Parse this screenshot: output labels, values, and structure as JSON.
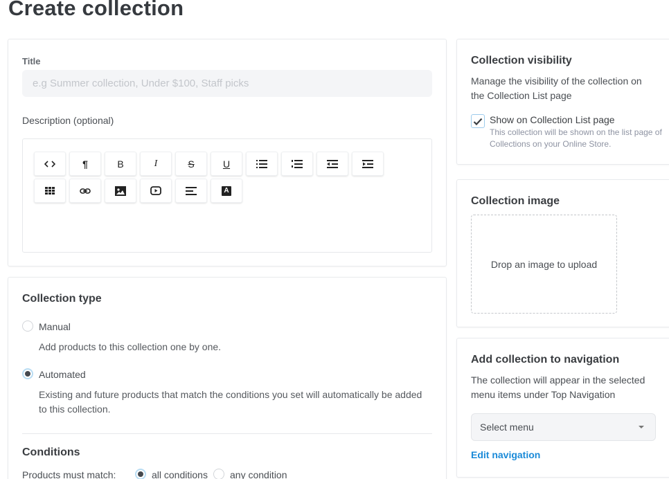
{
  "page": {
    "title": "Create collection"
  },
  "main_card": {
    "title_label": "Title",
    "title_placeholder": "e.g Summer collection, Under $100, Staff picks",
    "title_value": "",
    "description_label": "Description (optional)",
    "toolbar_row1": [
      {
        "name": "code-view",
        "icon": "code-icon",
        "glyph": "<>"
      },
      {
        "name": "paragraph",
        "icon": "paragraph-icon",
        "glyph": "¶"
      },
      {
        "name": "bold",
        "icon": "bold-icon",
        "glyph": "B"
      },
      {
        "name": "italic",
        "icon": "italic-icon",
        "glyph": "I"
      },
      {
        "name": "strikethrough",
        "icon": "strikethrough-icon",
        "glyph": "S"
      },
      {
        "name": "underline",
        "icon": "underline-icon",
        "glyph": "U"
      },
      {
        "name": "bullet-list",
        "icon": "bullet-list-icon",
        "glyph": ""
      },
      {
        "name": "numbered-list",
        "icon": "numbered-list-icon",
        "glyph": ""
      },
      {
        "name": "outdent",
        "icon": "outdent-icon",
        "glyph": ""
      },
      {
        "name": "indent",
        "icon": "indent-icon",
        "glyph": ""
      }
    ],
    "toolbar_row2": [
      {
        "name": "table",
        "icon": "table-icon"
      },
      {
        "name": "link",
        "icon": "link-icon"
      },
      {
        "name": "image",
        "icon": "image-icon"
      },
      {
        "name": "video",
        "icon": "video-icon"
      },
      {
        "name": "align",
        "icon": "align-left-icon"
      },
      {
        "name": "text-color",
        "icon": "text-color-icon",
        "glyph": "A"
      }
    ]
  },
  "type_card": {
    "heading": "Collection type",
    "options": [
      {
        "label": "Manual",
        "help": "Add products to this collection one by one.",
        "checked": false
      },
      {
        "label": "Automated",
        "help": "Existing and future products that match the conditions you set will automatically be added to this collection.",
        "checked": true
      }
    ],
    "conditions_heading": "Conditions",
    "match_label": "Products must match:",
    "match_options": [
      {
        "label": "all conditions",
        "checked": true
      },
      {
        "label": "any condition",
        "checked": false
      }
    ]
  },
  "visibility_card": {
    "heading": "Collection visibility",
    "description": "Manage the visibility of the collection on the Collection List page",
    "checkbox_label": "Show on Collection List page",
    "checkbox_checked": true,
    "checkbox_help": "This collection will be shown on the list page of Collections on your Online Store."
  },
  "image_card": {
    "heading": "Collection image",
    "dropzone_text": "Drop an image to upload"
  },
  "navigation_card": {
    "heading": "Add collection to navigation",
    "description": "The collection will appear in the selected menu items under Top Navigation",
    "select_value": "Select menu",
    "link_label": "Edit navigation",
    "link_color": "#1a8ad8"
  }
}
